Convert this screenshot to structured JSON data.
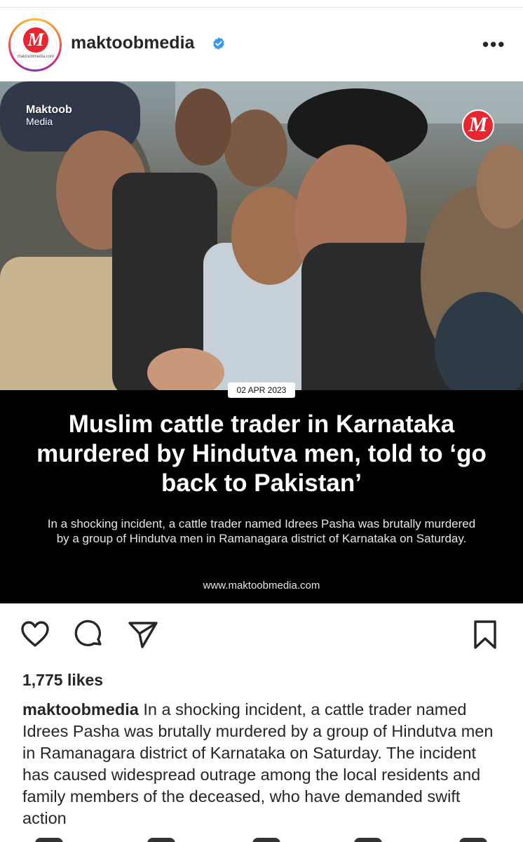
{
  "post": {
    "username": "maktoobmedia",
    "avatar_brand_text": "maktoobmedia.com",
    "watermark": {
      "title": "Maktoob",
      "subtitle": "Media"
    },
    "date_label": "02 APR 2023",
    "headline": "Muslim cattle trader in Karnataka murdered by Hindutva men, told to ‘go back to Pakistan’",
    "summary": "In a shocking incident, a cattle trader named Idrees Pasha was brutally murdered by a group of Hindutva men in Ramanagara district of Karnataka on Saturday.",
    "site_url": "www.maktoobmedia.com",
    "likes": "1,775 likes",
    "caption_user": "maktoobmedia",
    "caption_text": "In a shocking incident, a cattle trader named Idrees Pasha was brutally murdered by a group of Hindutva men in Ramanagara district of Karnataka on Saturday. The incident has caused widespread outrage among the local residents and family members of the deceased, who have demanded swift action"
  },
  "icons": {
    "verified": "verified-badge-icon",
    "more": "more-options-icon",
    "like": "heart-icon",
    "comment": "comment-icon",
    "share": "send-icon",
    "save": "bookmark-icon"
  },
  "colors": {
    "brand_red": "#e8262f",
    "verified_blue": "#3897f0"
  }
}
